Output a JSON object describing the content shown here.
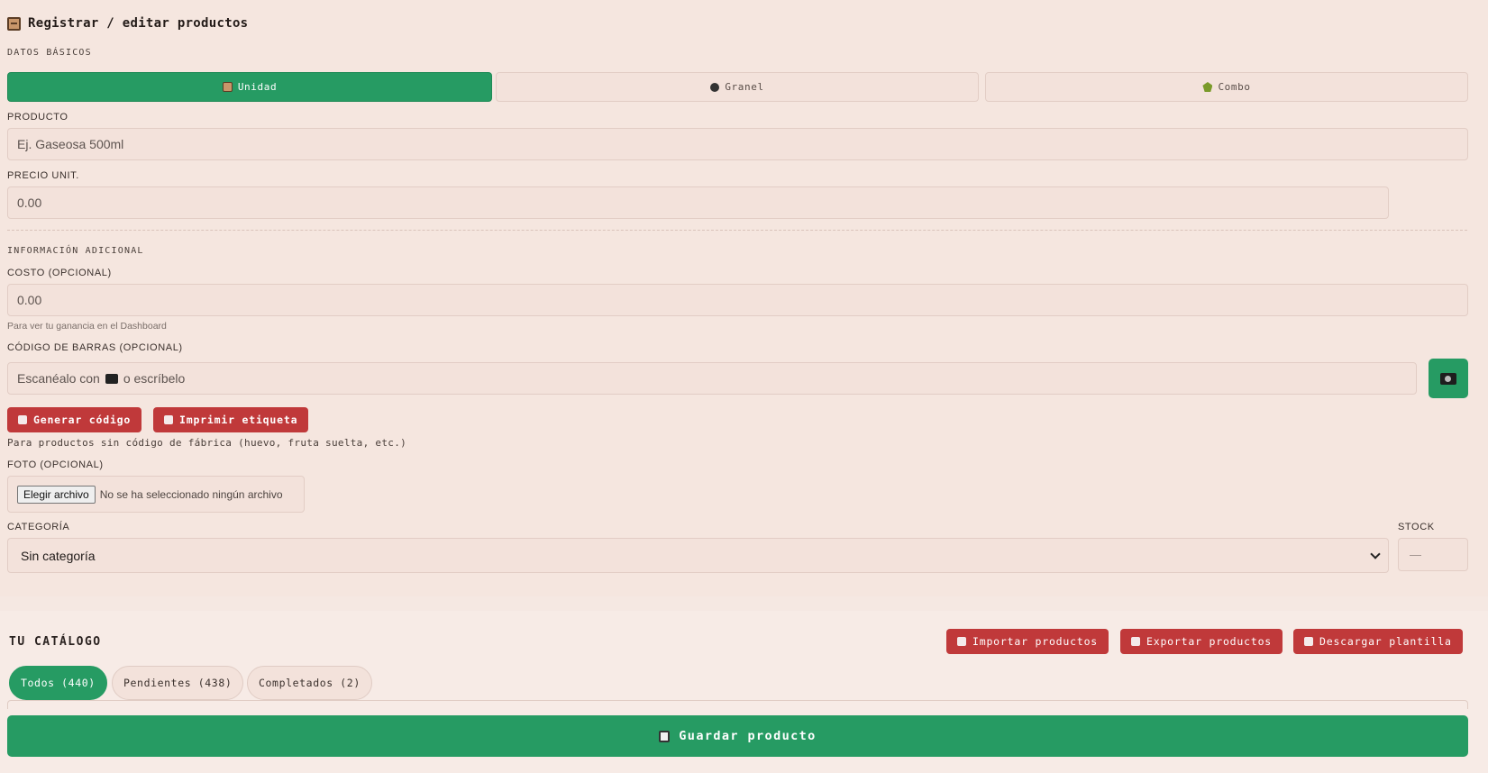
{
  "header": {
    "title": "Registrar / editar productos",
    "title_icon": "box-icon"
  },
  "basic": {
    "section_title": "DATOS BÁSICOS",
    "types": [
      {
        "label": "Unidad",
        "icon": "box-icon",
        "active": true
      },
      {
        "label": "Granel",
        "icon": "scale-icon",
        "active": false
      },
      {
        "label": "Combo",
        "icon": "combo-icon",
        "active": false
      }
    ],
    "product_label": "PRODUCTO",
    "product_placeholder": "Ej. Gaseosa 500ml",
    "price_label": "PRECIO UNIT.",
    "price_placeholder": "0.00"
  },
  "additional": {
    "section_title": "INFORMACIÓN ADICIONAL",
    "cost_label": "COSTO (OPCIONAL)",
    "cost_placeholder": "0.00",
    "cost_hint": "Para ver tu ganancia en el Dashboard",
    "barcode_label": "CÓDIGO DE BARRAS (OPCIONAL)",
    "barcode_placeholder_before": "Escanéalo con",
    "barcode_placeholder_after": "o escríbelo",
    "generate_label": "Generar código",
    "print_label": "Imprimir etiqueta",
    "barcode_hint": "Para productos sin código de fábrica (huevo, fruta suelta, etc.)",
    "photo_label": "FOTO (OPCIONAL)",
    "file_button": "Elegir archivo",
    "file_status": "No se ha seleccionado ningún archivo",
    "category_label": "CATEGORÍA",
    "category_value": "Sin categoría",
    "stock_label": "STOCK",
    "stock_placeholder": "—"
  },
  "catalog": {
    "title": "TU CATÁLOGO",
    "import_label": "Importar productos",
    "export_label": "Exportar productos",
    "template_label": "Descargar plantilla",
    "filters": [
      {
        "label": "Todos (440)",
        "active": true
      },
      {
        "label": "Pendientes (438)",
        "active": false
      },
      {
        "label": "Completados (2)",
        "active": false
      }
    ]
  },
  "save_label": "Guardar producto",
  "colors": {
    "primary_green": "#269b63",
    "danger_red": "#c0393a",
    "background": "#f5e8e2"
  }
}
